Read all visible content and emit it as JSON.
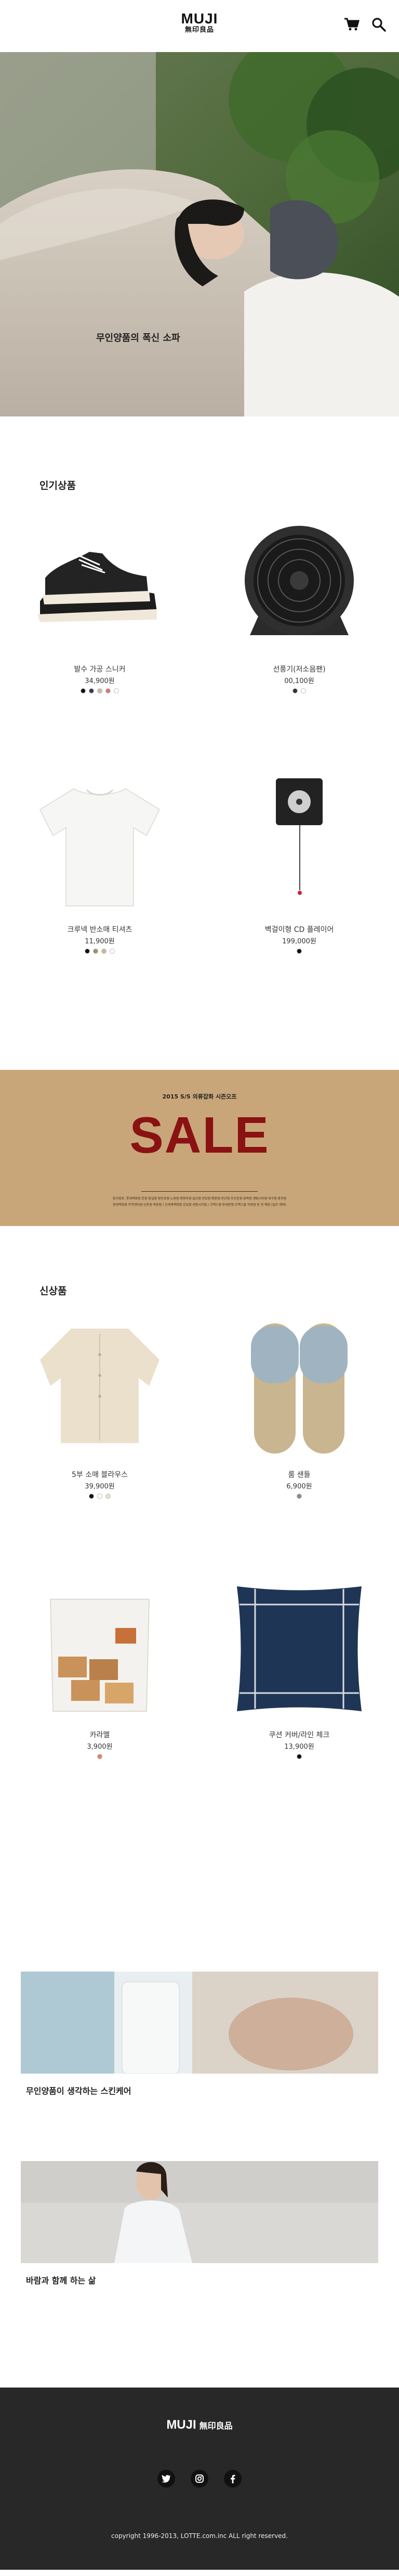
{
  "header": {
    "logo_latin": "MUJI",
    "logo_cjk": "無印良品",
    "icons": [
      "cart-icon",
      "search-icon"
    ]
  },
  "hero": {
    "caption": "무인양품의 폭신 소파"
  },
  "popular": {
    "title": "인기상품",
    "items": [
      {
        "name": "발수 가공 스니커",
        "price": "34,900원",
        "swatches": [
          "#111111",
          "#333a55",
          "#c9b9a5",
          "#d77a7a",
          "#ffffff"
        ]
      },
      {
        "name": "선풍기(저소음팬)",
        "price": "00,100원",
        "swatches": [
          "#333333",
          "#ffffff"
        ]
      },
      {
        "name": "크루넥 반소매 티셔츠",
        "price": "11,900원",
        "swatches": [
          "#111111",
          "#a08d6a",
          "#cbb99a",
          "#ffffff"
        ]
      },
      {
        "name": "벽걸이형 CD 플레이어",
        "price": "199,000원",
        "swatches": [
          "#111111"
        ]
      }
    ]
  },
  "sale": {
    "kicker": "2015 S/S 의류잡화 시즌오프",
    "word": "SALE",
    "fine_1": "참가점포: 롯데백화점 본점·잠실점·영등포점·노원점·청량리점·일산점·분당점·평촌점·안산점·부산본점·광복점·센텀시티점·대구점·광주점",
    "fine_2": "현대백화점 무역센터점·신촌점·목동점 / 신세계백화점 강남점·센텀시티점 / 코엑스점·동대문점·코엑스몰 직영점 등 전 매장 (일부 제외)"
  },
  "new_items": {
    "title": "신상품",
    "items": [
      {
        "name": "5부 소매 블라우스",
        "price": "39,900원",
        "swatches": [
          "#111111",
          "#ffffff",
          "#e8e0d0"
        ]
      },
      {
        "name": "룸 샌들",
        "price": "6,900원",
        "swatches": [
          "#8a8a8a"
        ]
      },
      {
        "name": "카라멜",
        "price": "3,900원",
        "swatches": [
          "#e4865c"
        ]
      },
      {
        "name": "쿠션 커버/라인 체크",
        "price": "13,900원",
        "swatches": [
          "#111111"
        ]
      }
    ]
  },
  "banners": [
    {
      "caption": "무인양품이 생각하는 스킨케어"
    },
    {
      "caption": "바람과 함께 하는 삶"
    }
  ],
  "footer": {
    "logo_latin": "MUJI",
    "logo_cjk": "無印良品",
    "social": [
      "twitter-icon",
      "instagram-icon",
      "facebook-icon"
    ],
    "copyright": "copyright 1996-2013, LOTTE.com.inc ALL right reserved."
  }
}
